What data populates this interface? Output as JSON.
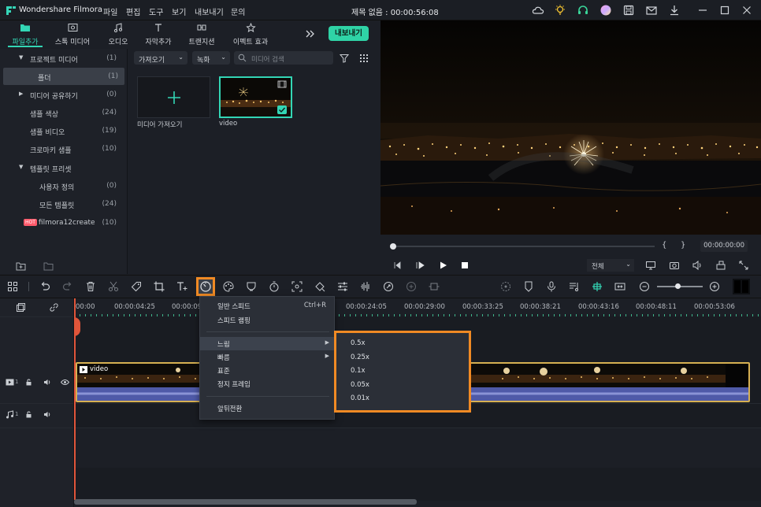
{
  "app_name": "Wondershare Filmora",
  "menu": [
    "파일",
    "편집",
    "도구",
    "보기",
    "내보내기",
    "문의"
  ],
  "window_title": "제목 없음 : 00:00:56:08",
  "title_icons": [
    "cloud-icon",
    "bulb-icon",
    "headset-icon",
    "avatar-icon",
    "save-icon",
    "mail-icon",
    "download-icon",
    "minimize-icon",
    "maximize-icon",
    "close-icon"
  ],
  "tabs": [
    "파일추가",
    "스톡 미디어",
    "오디오",
    "자막추가",
    "트랜지션",
    "이펙트 효과"
  ],
  "export_button": "내보내기",
  "accent_color": "#33d6b5",
  "sidebar": {
    "project_media": {
      "label": "프로젝트 미디어",
      "count": "(1)"
    },
    "folder": {
      "label": "폴더",
      "count": "(1)"
    },
    "shared_media": {
      "label": "미디어 공유하기",
      "count": "(0)"
    },
    "sample_color": {
      "label": "샘플 색상",
      "count": "(24)"
    },
    "sample_video": {
      "label": "샘플 비디오",
      "count": "(19)"
    },
    "chroma_sample": {
      "label": "크로마키 샘플",
      "count": "(10)"
    },
    "template_preset": {
      "label": "템플릿 프리셋",
      "count": ""
    },
    "custom": {
      "label": "사용자 정의",
      "count": "(0)"
    },
    "all_templates": {
      "label": "모든 템플릿",
      "count": "(24)"
    },
    "filmora_create": {
      "badge": "HOT",
      "label": "filmora12create",
      "count": "(10)"
    }
  },
  "media": {
    "import_dropdown": "가져오기",
    "record_dropdown": "녹화",
    "search_placeholder": "미디어 검색",
    "import_tile_label": "미디어 가져오기",
    "video_tile_label": "video"
  },
  "preview": {
    "time": "00:00:00:00",
    "quality": "전체",
    "bracket_in": "{",
    "bracket_out": "}"
  },
  "timeline": {
    "ruler": [
      "00:00",
      "00:00:04:25",
      "00:00:09",
      "00:00:24:05",
      "00:00:29:00",
      "00:00:33:25",
      "00:00:38:21",
      "00:00:43:16",
      "00:00:48:11",
      "00:00:53:06"
    ],
    "video_track_num": "1",
    "audio_track_num": "1",
    "clip_name": "video"
  },
  "context_menu": {
    "items": [
      {
        "label": "일반 스피드",
        "shortcut": "Ctrl+R"
      },
      {
        "label": "스피드 램핑",
        "shortcut": ""
      },
      {
        "label": "느림",
        "shortcut": ""
      },
      {
        "label": "빠름",
        "shortcut": ""
      },
      {
        "label": "표준",
        "shortcut": ""
      },
      {
        "label": "정지 프레임",
        "shortcut": ""
      },
      {
        "label": "앞뒤전환",
        "shortcut": ""
      }
    ],
    "submenu": [
      "0.5x",
      "0.25x",
      "0.1x",
      "0.05x",
      "0.01x"
    ]
  },
  "highlight_color": "#f08a24"
}
